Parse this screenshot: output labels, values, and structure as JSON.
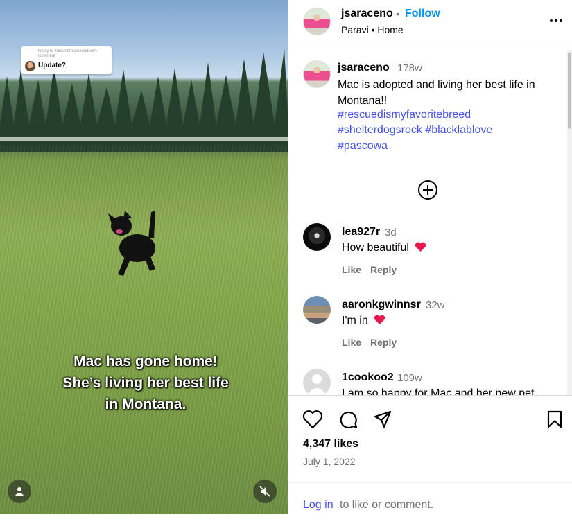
{
  "video": {
    "reply_sticker": {
      "small_text": "Reply to ifufoundthisnoudidnet's comment",
      "text": "Update?"
    },
    "caption_lines": [
      "Mac has gone home!",
      "She’s living her best life",
      "in Montana."
    ],
    "user_icon": "user-icon",
    "mute_icon": "muted-speaker-icon"
  },
  "header": {
    "username": "jsaraceno",
    "separator": "•",
    "follow_label": "Follow",
    "subtitle": "Paravi • Home",
    "more_icon": "more-options-icon"
  },
  "post_caption": {
    "username": "jsaraceno",
    "time": "178w",
    "text": "Mac is adopted and living her best life in Montana!!",
    "hashtags": [
      "#rescuedismyfavoritebreed",
      "#shelterdogsrock #blacklablove",
      "#pascowa"
    ]
  },
  "load_more_icon": "plus-circle-icon",
  "comments": [
    {
      "username": "lea927r",
      "time": "3d",
      "text": "How beautiful",
      "emoji": "heart",
      "like_label": "Like",
      "reply_label": "Reply"
    },
    {
      "username": "aaronkgwinnsr",
      "time": "32w",
      "text": "I'm in",
      "emoji": "heart",
      "like_label": "Like",
      "reply_label": "Reply"
    },
    {
      "username": "1cookoo2",
      "time": "109w",
      "text": "I am so happy for Mac and her new pet"
    }
  ],
  "actions": {
    "icons": [
      "heart-outline-icon",
      "comment-icon",
      "share-icon",
      "bookmark-icon"
    ],
    "likes": "4,347 likes",
    "date": "July 1, 2022"
  },
  "login": {
    "link": "Log in",
    "rest": "to like or comment."
  },
  "colors": {
    "link_blue": "#4150f7",
    "follow_blue": "#0095f6",
    "muted_gray": "#737373",
    "heart_red": "#e8194b"
  }
}
